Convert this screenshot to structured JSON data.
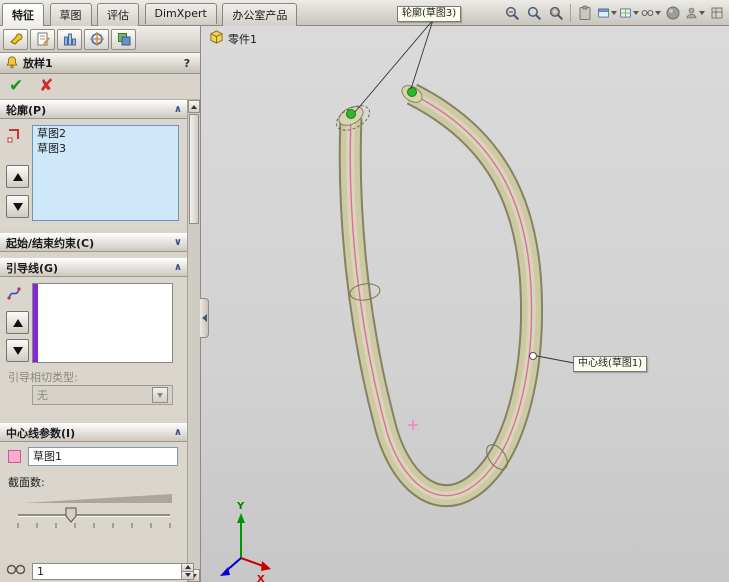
{
  "tab_bar": {
    "tabs": [
      {
        "label": "特征",
        "active": true
      },
      {
        "label": "草图",
        "active": false
      },
      {
        "label": "评估",
        "active": false
      },
      {
        "label": "DimXpert",
        "active": false
      },
      {
        "label": "办公室产品",
        "active": false
      }
    ],
    "toolbar_icon_names": [
      "zoom-in-out",
      "zoom-to-fit",
      "zoom-to-area",
      "clipboard",
      "section-view",
      "display-style",
      "view-orientation",
      "appearance",
      "user",
      "options-grid"
    ]
  },
  "feature_tree": {
    "part_label": "零件1"
  },
  "property_manager": {
    "title": "放样1",
    "help_label": "?",
    "tab_icon_names": [
      "featuremanager",
      "propertymanager",
      "configurationmanager",
      "dimxpertmanager",
      "displaymanager"
    ],
    "profiles_group": {
      "header": "轮廓(P)",
      "items": [
        "草图2",
        "草图3"
      ]
    },
    "start_end_group": {
      "header": "起始/结束约束(C)"
    },
    "guide_curves_group": {
      "header": "引导线(G)",
      "tangency_label": "引导相切类型:",
      "tangency_value": "无"
    },
    "centerline_group": {
      "header": "中心线参数(I)",
      "centerline_value": "草图1",
      "sections_label": "截面数:"
    },
    "preview_spinner_value": "1"
  },
  "viewport": {
    "callouts": {
      "profile": "轮廓(草图3)",
      "centerline": "中心线(草图1)"
    },
    "triad": {
      "x_label": "X",
      "y_label": "Y"
    },
    "colors": {
      "tube_fill": "#cdc9a5",
      "tube_edge": "#85835f",
      "centerline_pink": "#e06ba8",
      "vertex_green": "#2db82d",
      "selection_blue": "#cfe8f9",
      "guide_purple": "#8426d9"
    }
  }
}
